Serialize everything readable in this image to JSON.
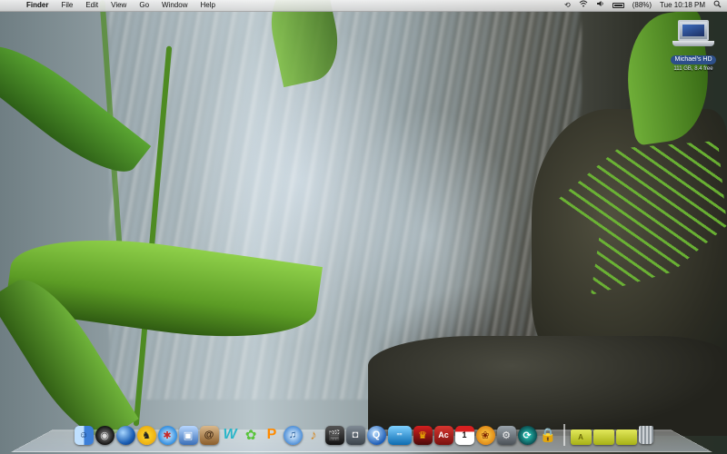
{
  "menubar": {
    "apple_icon": "",
    "app_name": "Finder",
    "menus": [
      "File",
      "Edit",
      "View",
      "Go",
      "Window",
      "Help"
    ],
    "status": {
      "timemachine_icon": "⟲",
      "wifi_icon": "wifi-icon",
      "volume_icon": "volume-icon",
      "battery_percent": "(88%)",
      "clock": "Tue 10:18 PM",
      "spotlight_icon": "search-icon"
    }
  },
  "desktop": {
    "disk": {
      "name": "Michael's HD",
      "info_left": "111 GB",
      "info_right": "8.4 free"
    }
  },
  "dock": {
    "apps": [
      {
        "name": "Finder",
        "glyph": "☺"
      },
      {
        "name": "Dashboard",
        "glyph": "◉"
      },
      {
        "name": "Google Earth",
        "glyph": ""
      },
      {
        "name": "AIM",
        "glyph": "♞"
      },
      {
        "name": "Safari",
        "glyph": "✱"
      },
      {
        "name": "Preview",
        "glyph": "▣"
      },
      {
        "name": "Address Book",
        "glyph": "@"
      },
      {
        "name": "iWeb",
        "glyph": "W"
      },
      {
        "name": "Frogger",
        "glyph": "✿"
      },
      {
        "name": "App P",
        "glyph": "P"
      },
      {
        "name": "iTunes",
        "glyph": "♫"
      },
      {
        "name": "GarageBand",
        "glyph": "♪"
      },
      {
        "name": "iMovie",
        "glyph": "🎬"
      },
      {
        "name": "iPhoto",
        "glyph": "◘"
      },
      {
        "name": "QuickTime",
        "glyph": "Q"
      },
      {
        "name": "Banner",
        "glyph": "=="
      },
      {
        "name": "Game",
        "glyph": "♛"
      },
      {
        "name": "Acrobat",
        "glyph": "Ac"
      },
      {
        "name": "iCal",
        "glyph": "1"
      },
      {
        "name": "Photo Booth",
        "glyph": "❀"
      },
      {
        "name": "System Preferences",
        "glyph": "⚙"
      },
      {
        "name": "Time Machine",
        "glyph": "⟳"
      },
      {
        "name": "Keychain",
        "glyph": "🔒"
      }
    ],
    "folders": [
      {
        "name": "Applications",
        "glyph": "A"
      },
      {
        "name": "Documents",
        "glyph": ""
      },
      {
        "name": "Downloads",
        "glyph": ""
      }
    ],
    "trash_icon": "trash-icon"
  }
}
